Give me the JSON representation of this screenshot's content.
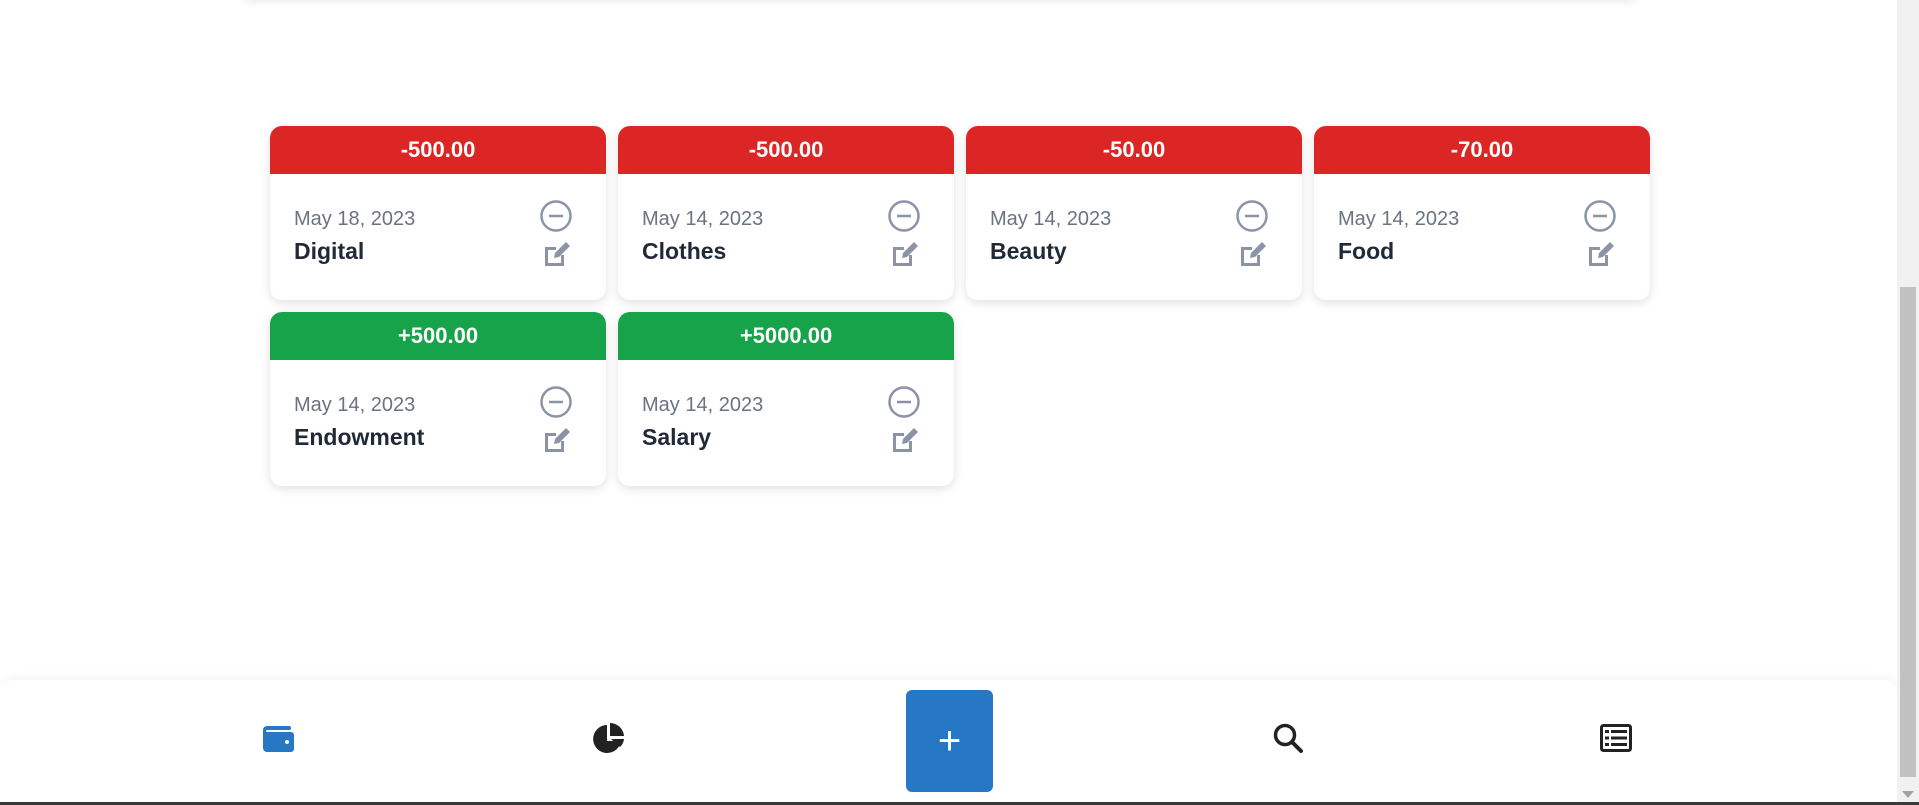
{
  "transactions": [
    {
      "amount": "-500.00",
      "type": "expense",
      "date": "May 18, 2023",
      "category": "Digital"
    },
    {
      "amount": "-500.00",
      "type": "expense",
      "date": "May 14, 2023",
      "category": "Clothes"
    },
    {
      "amount": "-50.00",
      "type": "expense",
      "date": "May 14, 2023",
      "category": "Beauty"
    },
    {
      "amount": "-70.00",
      "type": "expense",
      "date": "May 14, 2023",
      "category": "Food"
    },
    {
      "amount": "+500.00",
      "type": "income",
      "date": "May 14, 2023",
      "category": "Endowment"
    },
    {
      "amount": "+5000.00",
      "type": "income",
      "date": "May 14, 2023",
      "category": "Salary"
    }
  ],
  "nav": {
    "wallet_icon": "wallet-icon",
    "stats_icon": "pie-chart-icon",
    "add_label": "+",
    "search_icon": "search-icon",
    "list_icon": "list-icon"
  },
  "colors": {
    "expense": "#dc2626",
    "income": "#16a34a",
    "accent": "#2778c4",
    "icon_gray": "#8b93a7"
  }
}
